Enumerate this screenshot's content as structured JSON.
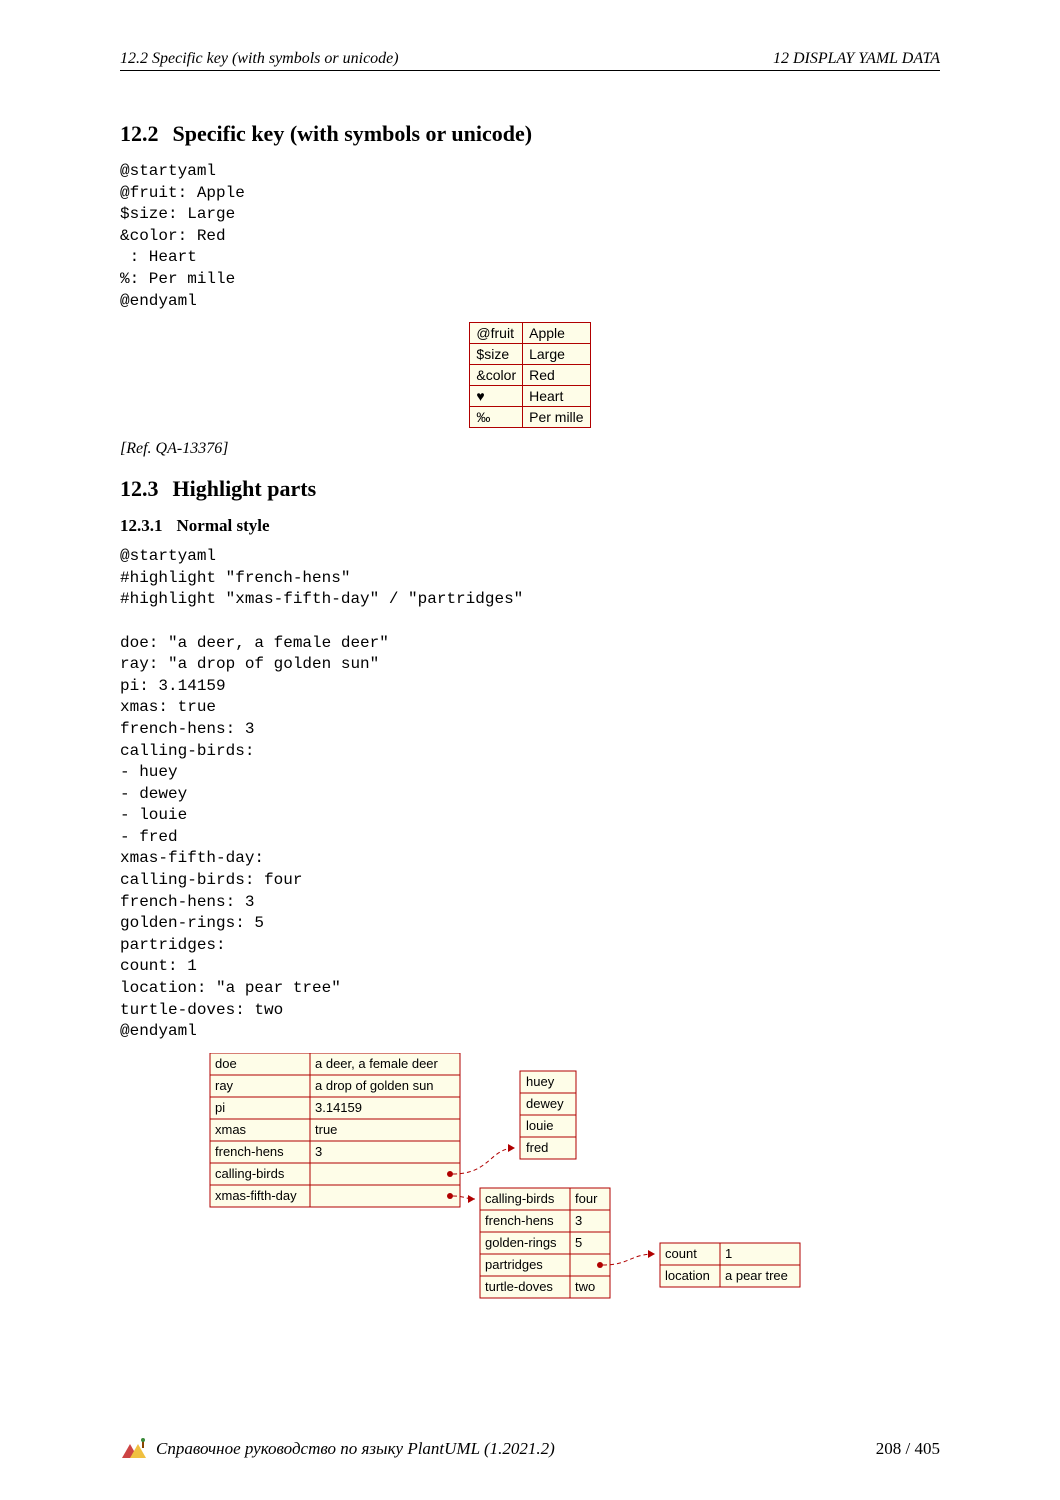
{
  "header": {
    "left": "12.2   Specific key (with symbols or unicode)",
    "right": "12   DISPLAY YAML DATA"
  },
  "section_12_2": {
    "num": "12.2",
    "title": "Specific key (with symbols or unicode)",
    "code": "@startyaml\n@fruit: Apple\n$size: Large\n&color: Red\n : Heart\n%: Per mille\n@endyaml",
    "table": [
      {
        "k": "@fruit",
        "v": "Apple"
      },
      {
        "k": "$size",
        "v": "Large"
      },
      {
        "k": "&color",
        "v": "Red"
      },
      {
        "k": "♥",
        "v": "Heart"
      },
      {
        "k": "‰",
        "v": "Per mille"
      }
    ],
    "ref": "[Ref. QA-13376]"
  },
  "section_12_3": {
    "num": "12.3",
    "title": "Highlight parts",
    "sub_num": "12.3.1",
    "sub_title": "Normal style",
    "code": "@startyaml\n#highlight \"french-hens\"\n#highlight \"xmas-fifth-day\" / \"partridges\"\n\ndoe: \"a deer, a female deer\"\nray: \"a drop of golden sun\"\npi: 3.14159\nxmas: true\nfrench-hens: 3\ncalling-birds:\n- huey\n- dewey\n- louie\n- fred\nxmas-fifth-day:\ncalling-birds: four\nfrench-hens: 3\ngolden-rings: 5\npartridges:\ncount: 1\nlocation: \"a pear tree\"\nturtle-doves: two\n@endyaml"
  },
  "diagram": {
    "root": [
      {
        "k": "doe",
        "v": "a deer, a female deer"
      },
      {
        "k": "ray",
        "v": "a drop of golden sun"
      },
      {
        "k": "pi",
        "v": "3.14159"
      },
      {
        "k": "xmas",
        "v": "true"
      },
      {
        "k": "french-hens",
        "v": "3"
      },
      {
        "k": "calling-birds",
        "v": ""
      },
      {
        "k": "xmas-fifth-day",
        "v": ""
      }
    ],
    "birds": [
      "huey",
      "dewey",
      "louie",
      "fred"
    ],
    "fifth": [
      {
        "k": "calling-birds",
        "v": "four"
      },
      {
        "k": "french-hens",
        "v": "3"
      },
      {
        "k": "golden-rings",
        "v": "5"
      },
      {
        "k": "partridges",
        "v": ""
      },
      {
        "k": "turtle-doves",
        "v": "two"
      }
    ],
    "partridges": [
      {
        "k": "count",
        "v": "1"
      },
      {
        "k": "location",
        "v": "a pear tree"
      }
    ]
  },
  "footer": {
    "title": "Справочное руководство по языку PlantUML (1.2021.2)",
    "page": "208 / 405"
  }
}
